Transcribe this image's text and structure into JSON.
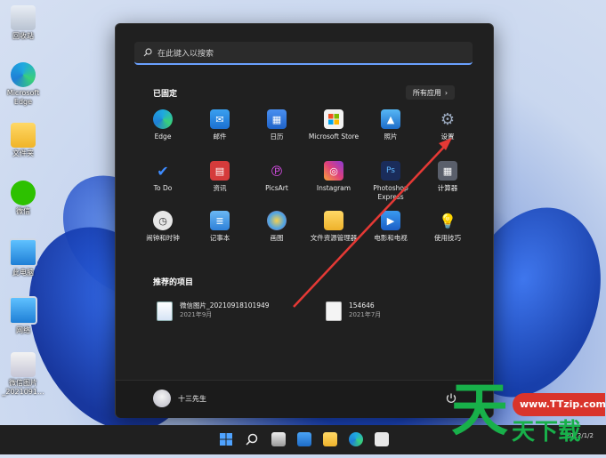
{
  "desktop": {
    "icons": [
      {
        "label": "回收站",
        "icon": "recycle-bin-icon"
      },
      {
        "label": "Microsoft Edge",
        "icon": "edge-icon"
      },
      {
        "label": "文件夹",
        "icon": "folder-icon"
      },
      {
        "label": "微信",
        "icon": "wechat-icon"
      },
      {
        "label": "此电脑",
        "icon": "computer-icon"
      },
      {
        "label": "网络",
        "icon": "network-icon"
      },
      {
        "label": "微信图片_2021091...",
        "icon": "image-file-icon"
      }
    ]
  },
  "start_menu": {
    "search_placeholder": "在此键入以搜索",
    "pinned_title": "已固定",
    "all_apps_label": "所有应用",
    "pinned_apps": [
      {
        "label": "Edge",
        "icon": "edge-icon",
        "color": "#1f9fd8"
      },
      {
        "label": "邮件",
        "icon": "mail-icon",
        "color": "#1b78d6"
      },
      {
        "label": "日历",
        "icon": "calendar-icon",
        "color": "#2a73d8"
      },
      {
        "label": "Microsoft Store",
        "icon": "store-icon",
        "color": "#f2f2f2"
      },
      {
        "label": "照片",
        "icon": "photos-icon",
        "color": "#2f8fd9"
      },
      {
        "label": "设置",
        "icon": "gear-icon",
        "color": "#7a8aa0"
      },
      {
        "label": "To Do",
        "icon": "todo-icon",
        "color": "#2b6fe0"
      },
      {
        "label": "资讯",
        "icon": "news-icon",
        "color": "#d53b3b"
      },
      {
        "label": "PicsArt",
        "icon": "picsart-icon",
        "color": "#c83bd6"
      },
      {
        "label": "Instagram",
        "icon": "instagram-icon",
        "color": "#e0407a"
      },
      {
        "label": "Photoshop Express",
        "icon": "photoshop-icon",
        "color": "#1a2c5a"
      },
      {
        "label": "计算器",
        "icon": "calculator-icon",
        "color": "#5a5f6b"
      },
      {
        "label": "闹钟和时钟",
        "icon": "clock-icon",
        "color": "#e6e6e6"
      },
      {
        "label": "记事本",
        "icon": "notepad-icon",
        "color": "#3a8ee6"
      },
      {
        "label": "画图",
        "icon": "paint-icon",
        "color": "#4aa3e8"
      },
      {
        "label": "文件资源管理器",
        "icon": "file-explorer-icon",
        "color": "#f3c23a"
      },
      {
        "label": "电影和电视",
        "icon": "movies-icon",
        "color": "#2a7fd8"
      },
      {
        "label": "使用技巧",
        "icon": "tips-icon",
        "color": "#2f9ae6"
      }
    ],
    "recommended_title": "推荐的项目",
    "recommended": [
      {
        "name": "微信图片_20210918101949",
        "date": "2021年9月",
        "icon": "image-file-icon"
      },
      {
        "name": "154646",
        "date": "2021年7月",
        "icon": "document-icon"
      }
    ],
    "user_name": "十三先生"
  },
  "taskbar": {
    "icons": [
      "start-icon",
      "search-icon",
      "task-view-icon",
      "widgets-icon",
      "file-explorer-icon",
      "edge-icon",
      "store-icon"
    ],
    "tray_date": "2022/1/2"
  },
  "watermark": {
    "url": "www.TTzip.com",
    "big_char": "天",
    "small_chars": "天下载"
  },
  "colors": {
    "accent": "#6aa0ff",
    "arrow": "#e53935",
    "watermark_green": "#18b04a",
    "watermark_red": "#d9342b"
  }
}
